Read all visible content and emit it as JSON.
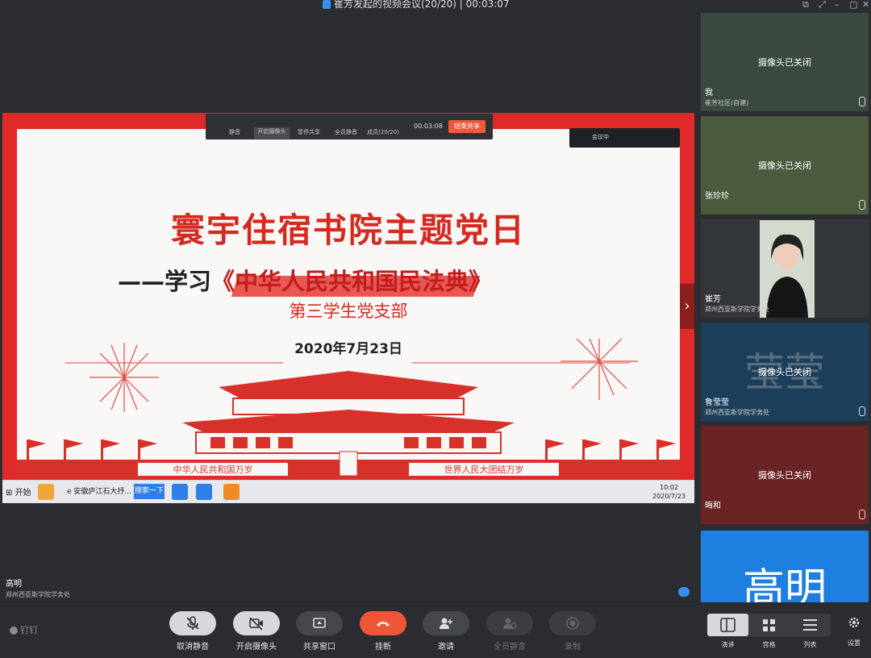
{
  "window": {
    "title": "崔芳发起的视频会议(20/20)",
    "separator": "|",
    "elapsed": "00:03:07"
  },
  "slide": {
    "title": "寰宇住宿书院主题党日",
    "subtitle_prefix": "——学习",
    "subtitle_highlight": "《中华人民共和国民法典》",
    "branch": "第三学生党支部",
    "date": "2020年7月23日",
    "banner_left": "中华人民共和国万岁",
    "banner_right": "世界人民大团结万岁"
  },
  "desktop_taskbar": {
    "start": "开始",
    "task": "安徽庐江石大抒...",
    "search_button": "搜索一下",
    "clock_time": "10:02",
    "clock_date": "2020/7/23"
  },
  "share_toolbar": {
    "items": [
      "静音",
      "开启摄像头",
      "暂停共享",
      "全员静音",
      "成员(20/20)"
    ],
    "timer": "00:03:08",
    "end_share": "结束共享",
    "status_chip": "会议中"
  },
  "speaker": {
    "name": "高明",
    "org": "郑州西亚斯学院学务处"
  },
  "participants": [
    {
      "name": "我",
      "org": "崔芳社区(自建)",
      "status": "摄像头已关闭",
      "bg": "#3b4a3f"
    },
    {
      "name": "张珍珍",
      "org": "",
      "status": "摄像头已关闭",
      "bg": "#4c5a3e"
    },
    {
      "name": "崔芳",
      "org": "郑州西亚斯学院学务处",
      "status": "",
      "bg": "#33363b"
    },
    {
      "name": "鲁莹莹",
      "org": "郑州西亚斯学院学务处",
      "status": "摄像头已关闭",
      "bg": "#1d3f5c",
      "bgtext": "莹莹"
    },
    {
      "name": "晦和",
      "org": "",
      "status": "摄像头已关闭",
      "bg": "#6b2424"
    },
    {
      "name": "",
      "org": "",
      "status": "",
      "bg": "#1f7fe0",
      "bgtext": "高明"
    }
  ],
  "brand": "钉钉",
  "controls": [
    {
      "label": "取消静音",
      "icon": "mic-muted-icon"
    },
    {
      "label": "开启摄像头",
      "icon": "camera-off-icon"
    },
    {
      "label": "共享窗口",
      "icon": "share-screen-icon"
    },
    {
      "label": "挂断",
      "icon": "hang-up-icon"
    },
    {
      "label": "邀请",
      "icon": "invite-icon"
    },
    {
      "label": "全员静音",
      "icon": "mute-all-icon"
    },
    {
      "label": "录制",
      "icon": "record-icon"
    }
  ],
  "layout_options": [
    "演讲",
    "宫格",
    "列表"
  ],
  "settings_label": "设置",
  "colors": {
    "hangup": "#f05638",
    "accent": "#3a8ff0",
    "slide_red": "#e02a2a"
  }
}
